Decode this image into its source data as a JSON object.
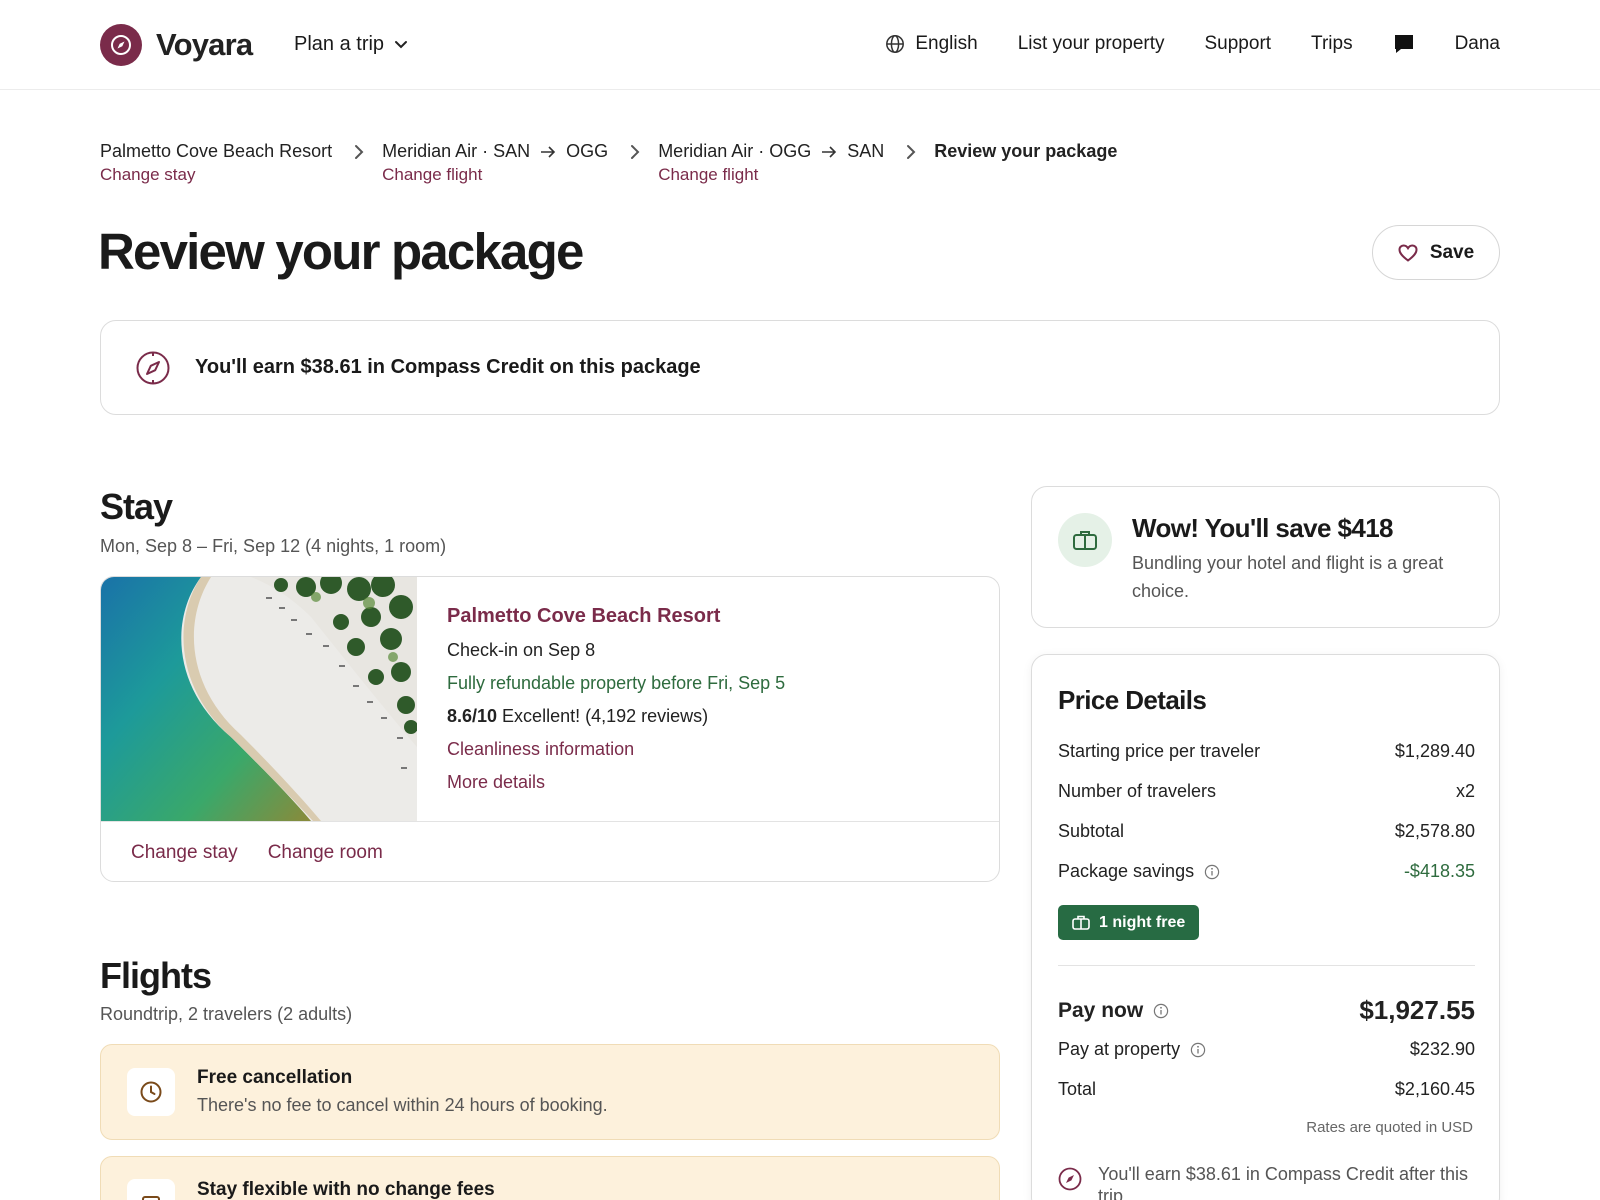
{
  "brand": {
    "name": "Voyara",
    "accent": "#7a2b4a",
    "green": "#2e6b3e"
  },
  "nav": {
    "plan_label": "Plan a trip",
    "language": "English",
    "list_property": "List your property",
    "support": "Support",
    "trips": "Trips",
    "user": "Dana"
  },
  "breadcrumb": {
    "stay": {
      "name": "Palmetto Cove Beach Resort",
      "action": "Change stay"
    },
    "outbound": {
      "carrier": "Meridian Air · SAN",
      "dest": "OGG",
      "action": "Change flight"
    },
    "return": {
      "carrier": "Meridian Air · OGG",
      "dest": "SAN",
      "action": "Change flight"
    },
    "current": "Review your package"
  },
  "page": {
    "title": "Review your package",
    "save_label": "Save"
  },
  "credit_banner": "You'll earn $38.61 in Compass Credit on this package",
  "stay": {
    "heading": "Stay",
    "dates": "Mon, Sep 8 – Fri, Sep 12 (4 nights, 1 room)",
    "hotel_name": "Palmetto Cove Beach Resort",
    "checkin": "Check-in on Sep 8",
    "refund": "Fully refundable property before Fri, Sep 5",
    "rating_score": "8.6/10",
    "rating_text": " Excellent! (4,192 reviews)",
    "cleanliness": "Cleanliness information",
    "more": "More details",
    "change_stay": "Change stay",
    "change_room": "Change room"
  },
  "flights": {
    "heading": "Flights",
    "sub": "Roundtrip, 2 travelers (2 adults)",
    "free_cancel_title": "Free cancellation",
    "free_cancel_desc": "There's no fee to cancel within 24 hours of booking.",
    "flex_title": "Stay flexible with no change fees"
  },
  "savings": {
    "title": "Wow! You'll save $418",
    "desc": "Bundling your hotel and flight is a great choice."
  },
  "price": {
    "title": "Price Details",
    "rows": [
      {
        "label": "Starting price per traveler",
        "value": "$1,289.40"
      },
      {
        "label": "Number of travelers",
        "value": "x2"
      },
      {
        "label": "Subtotal",
        "value": "$2,578.80"
      },
      {
        "label": "Package savings",
        "value": "-$418.35"
      }
    ],
    "badge": "1 night free",
    "pay_now_label": "Pay now",
    "pay_now_value": "$1,927.55",
    "pay_property_label": "Pay at property",
    "pay_property_value": "$232.90",
    "total_label": "Total",
    "total_value": "$2,160.45",
    "rates_note": "Rates are quoted in USD",
    "earn_after": "You'll earn $38.61 in Compass Credit after this trip"
  }
}
